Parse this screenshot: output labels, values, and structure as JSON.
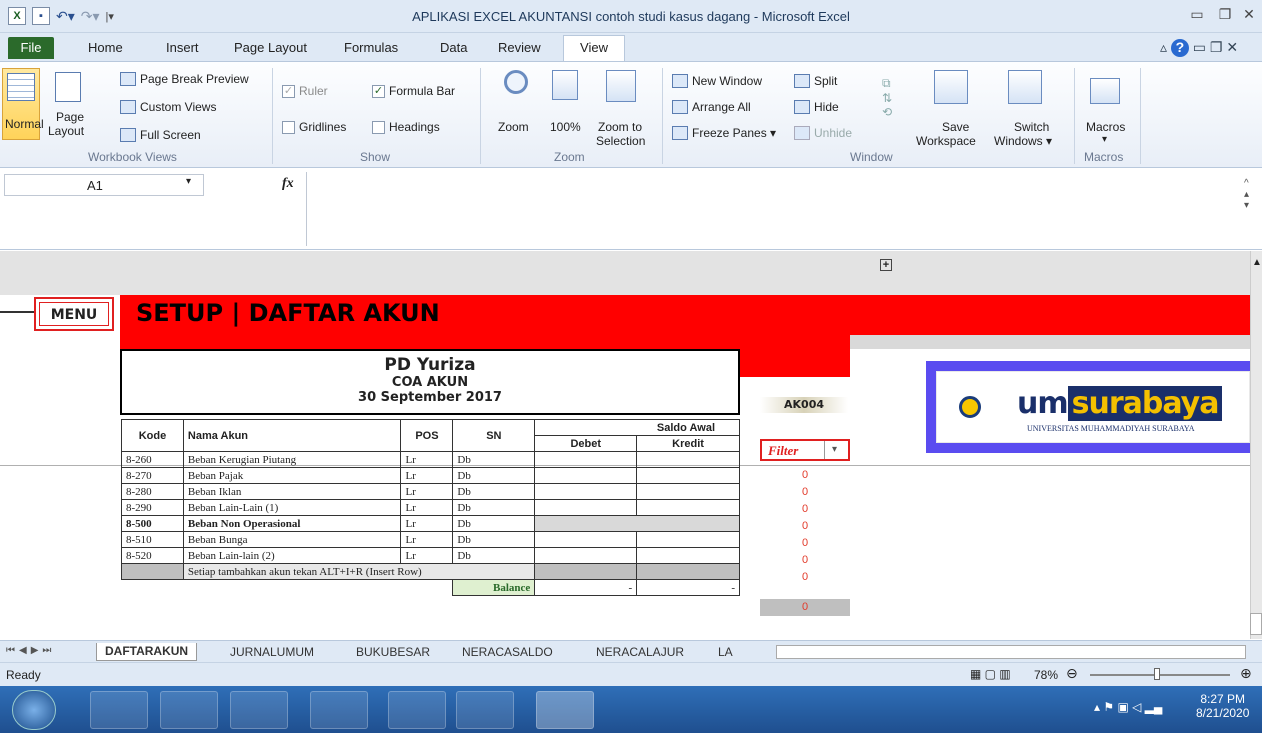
{
  "window": {
    "title": "APLIKASI EXCEL AKUNTANSI contoh studi kasus dagang - Microsoft Excel"
  },
  "tabs": [
    "File",
    "Home",
    "Insert",
    "Page Layout",
    "Formulas",
    "Data",
    "Review",
    "View"
  ],
  "ribbon": {
    "workbook_views": {
      "normal": "Normal",
      "page_layout_1": "Page",
      "page_layout_2": "Layout",
      "page_break": "Page Break Preview",
      "custom_views": "Custom Views",
      "full_screen": "Full Screen",
      "label": "Workbook Views"
    },
    "show": {
      "ruler": "Ruler",
      "formula_bar": "Formula Bar",
      "gridlines": "Gridlines",
      "headings": "Headings",
      "label": "Show"
    },
    "zoom": {
      "zoom": "Zoom",
      "pct": "100%",
      "zoom_sel_1": "Zoom to",
      "zoom_sel_2": "Selection",
      "label": "Zoom"
    },
    "window": {
      "new_window": "New Window",
      "arrange_all": "Arrange All",
      "freeze": "Freeze Panes ▾",
      "split": "Split",
      "hide": "Hide",
      "unhide": "Unhide",
      "save_ws_1": "Save",
      "save_ws_2": "Workspace",
      "switch_1": "Switch",
      "switch_2": "Windows ▾",
      "label": "Window"
    },
    "macros": {
      "macros": "Macros",
      "label": "Macros"
    }
  },
  "formula": {
    "name_box": "A1",
    "fx": "fx"
  },
  "sheet": {
    "menu": "MENU",
    "header": "SETUP | DAFTAR AKUN",
    "company": "PD Yuriza",
    "subtitle": "COA AKUN",
    "date": "30 September 2017",
    "code": "AK004",
    "filter": "Filter",
    "logo_um": "um",
    "logo_surabaya": "surabaya",
    "logo_sub": "UNIVERSITAS MUHAMMADIYAH SURABAYA",
    "columns": {
      "kode": "Kode",
      "nama": "Nama Akun",
      "pos": "POS",
      "sn": "SN",
      "saldo": "Saldo Awal",
      "debet": "Debet",
      "kredit": "Kredit"
    },
    "rows": [
      {
        "kode": "8-260",
        "nama": "Beban Kerugian Piutang",
        "pos": "Lr",
        "sn": "Db",
        "filter": "0"
      },
      {
        "kode": "8-270",
        "nama": "Beban Pajak",
        "pos": "Lr",
        "sn": "Db",
        "filter": "0"
      },
      {
        "kode": "8-280",
        "nama": "Beban Iklan",
        "pos": "Lr",
        "sn": "Db",
        "filter": "0"
      },
      {
        "kode": "8-290",
        "nama": "Beban Lain-Lain (1)",
        "pos": "Lr",
        "sn": "Db",
        "filter": "0"
      },
      {
        "kode": "8-500",
        "nama": "Beban Non Operasional",
        "pos": "Lr",
        "sn": "Db",
        "filter": "0",
        "bold": true
      },
      {
        "kode": "8-510",
        "nama": "Beban Bunga",
        "pos": "Lr",
        "sn": "Db",
        "filter": "0"
      },
      {
        "kode": "8-520",
        "nama": "Beban Lain-lain (2)",
        "pos": "Lr",
        "sn": "Db",
        "filter": "0"
      }
    ],
    "insert_note": "Setiap tambahkan akun tekan ALT+I+R (Insert Row)",
    "insert_filter": "0",
    "balance": "Balance",
    "balance_debet": "-",
    "balance_kredit": "-"
  },
  "sheet_tabs": [
    "DAFTARAKUN",
    "JURNALUMUM",
    "BUKUBESAR",
    "NERACASALDO",
    "NERACALAJUR",
    "LA"
  ],
  "status": {
    "ready": "Ready",
    "zoom": "78%"
  },
  "clock": {
    "time": "8:27 PM",
    "date": "8/21/2020"
  }
}
